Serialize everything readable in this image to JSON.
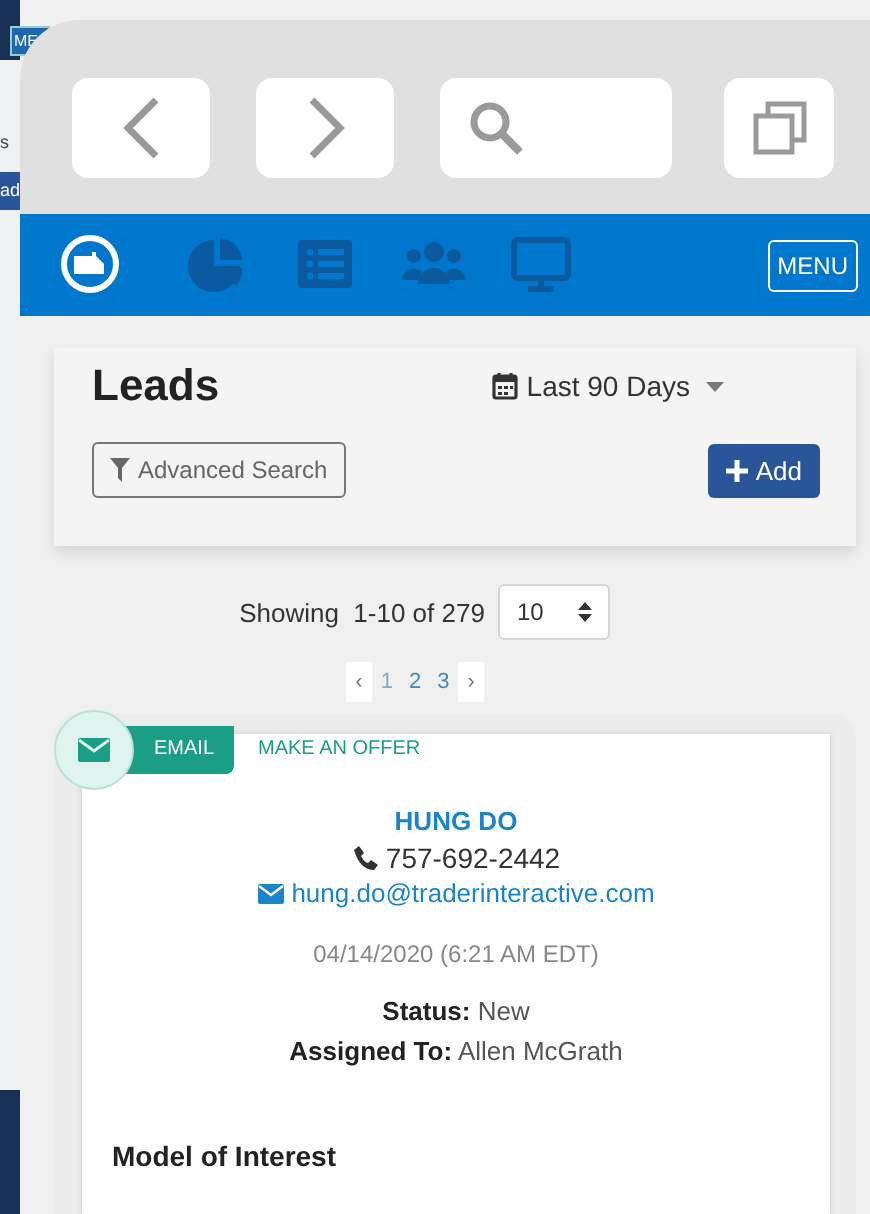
{
  "background_page": {
    "menu_fragment": "ME",
    "label_fragment": "s",
    "button_fragment": "ad"
  },
  "browser_toolbar": {
    "buttons": [
      {
        "kind": "back"
      },
      {
        "kind": "forward"
      },
      {
        "kind": "search"
      },
      {
        "kind": "tabs"
      }
    ]
  },
  "nav_bar": {
    "items": [
      {
        "kind": "logo"
      },
      {
        "kind": "chart"
      },
      {
        "kind": "list"
      },
      {
        "kind": "people"
      },
      {
        "kind": "monitor"
      }
    ],
    "menu_button": "MENU"
  },
  "header": {
    "title": "Leads",
    "date_range": "Last 90 Days",
    "advanced_search": "Advanced Search",
    "add_button": "Add"
  },
  "pagination": {
    "showing": "Showing  1-10 of 279",
    "page_size": "10",
    "prev": "‹",
    "pages": [
      {
        "label": "1",
        "selected": true
      },
      {
        "label": "2",
        "selected": false
      },
      {
        "label": "3",
        "selected": false
      }
    ],
    "next": "›"
  },
  "lead": {
    "actions": [
      {
        "label": "EMAIL",
        "selected": true
      },
      {
        "label": "MAKE AN OFFER",
        "selected": false
      }
    ],
    "name": "HUNG DO",
    "phone": "757-692-2442",
    "email": "hung.do@traderinteractive.com",
    "date": "04/14/2020 (6:21 AM EDT)",
    "status": "**Status:** New",
    "assigned": "**Assigned To:** Allen McGrath",
    "section_title": "Model of Interest"
  }
}
